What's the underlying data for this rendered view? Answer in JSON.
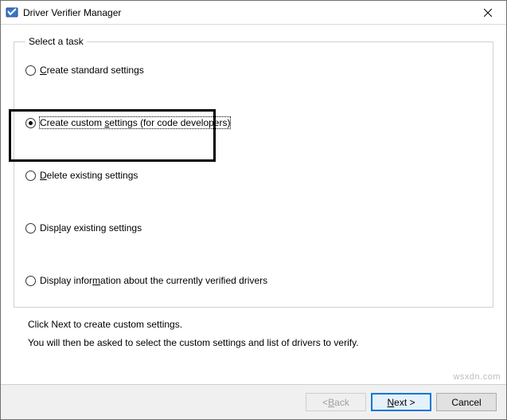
{
  "window": {
    "title": "Driver Verifier Manager"
  },
  "group": {
    "legend": "Select a task"
  },
  "tasks": [
    {
      "id": "create-standard",
      "label_pre": "",
      "label_acc": "C",
      "label_post": "reate standard settings",
      "checked": false
    },
    {
      "id": "create-custom",
      "label_pre": "Create custom ",
      "label_acc": "s",
      "label_post": "ettings (for code developers)",
      "checked": true
    },
    {
      "id": "delete-existing",
      "label_pre": "",
      "label_acc": "D",
      "label_post": "elete existing settings",
      "checked": false
    },
    {
      "id": "display-existing",
      "label_pre": "Disp",
      "label_acc": "l",
      "label_post": "ay existing settings",
      "checked": false
    },
    {
      "id": "display-info",
      "label_pre": "Display infor",
      "label_acc": "m",
      "label_post": "ation about the currently verified drivers",
      "checked": false
    }
  ],
  "instructions": {
    "line1": "Click Next to create custom settings.",
    "line2": "You will then be asked to select the custom settings and list of drivers to verify."
  },
  "buttons": {
    "back_pre": "< ",
    "back_acc": "B",
    "back_post": "ack",
    "next_pre": "",
    "next_acc": "N",
    "next_post": "ext >",
    "cancel": "Cancel"
  },
  "watermark": "wsxdn.com"
}
